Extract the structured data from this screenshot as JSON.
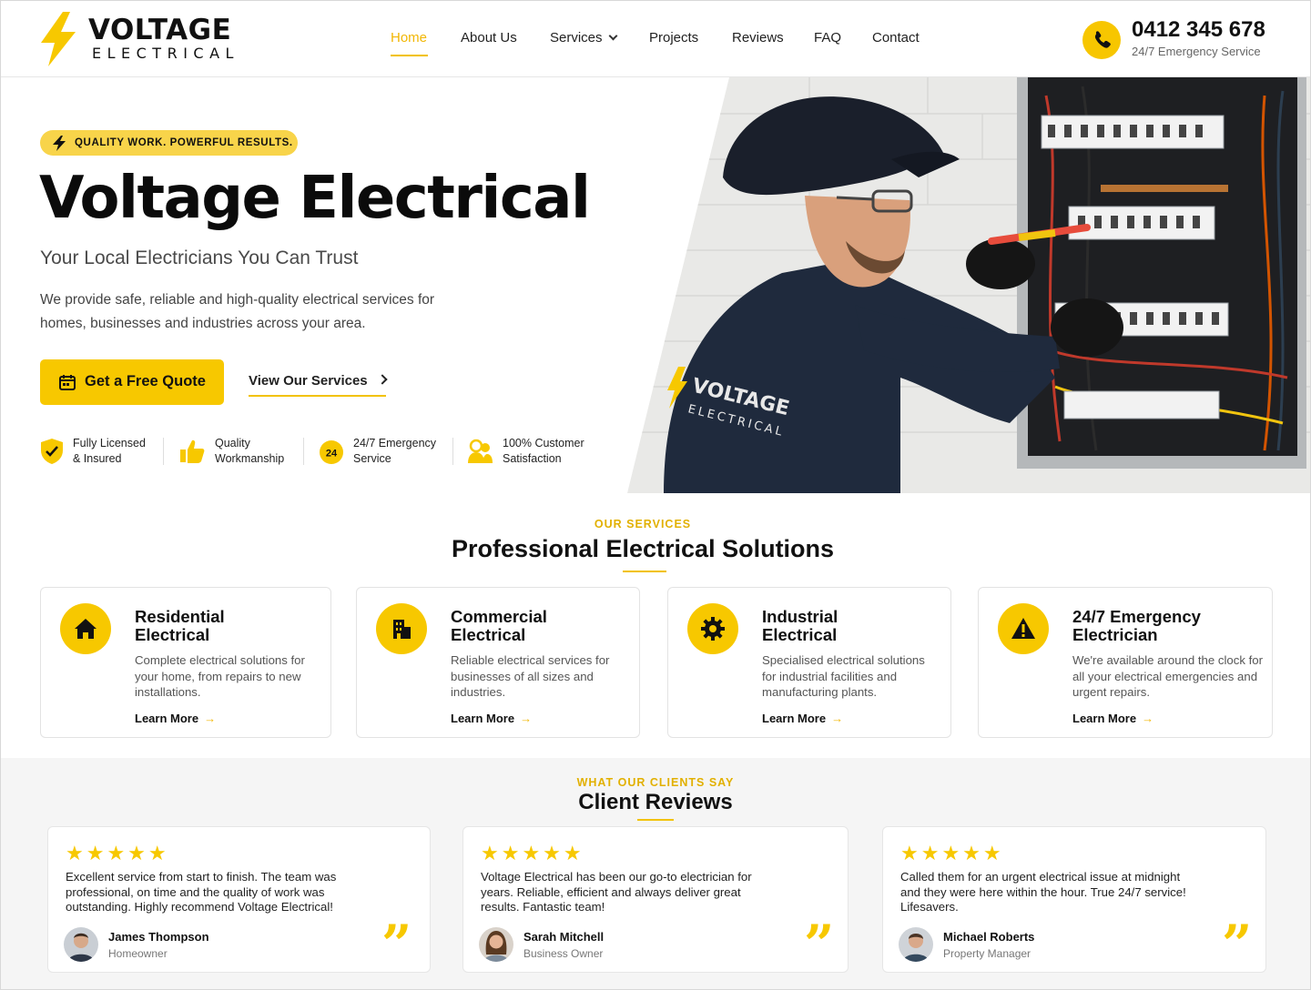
{
  "brand": {
    "name": "VOLTAGE",
    "tagline": "ELECTRICAL",
    "accent_color": "#F7C800"
  },
  "nav": {
    "items": [
      {
        "label": "Home",
        "active": true
      },
      {
        "label": "About Us",
        "active": false
      },
      {
        "label": "Services",
        "active": false,
        "has_dropdown": true
      },
      {
        "label": "Projects",
        "active": false
      },
      {
        "label": "Reviews",
        "active": false
      },
      {
        "label": "FAQ",
        "active": false
      },
      {
        "label": "Contact",
        "active": false
      }
    ]
  },
  "contact": {
    "phone": "0412 345 678",
    "note": "24/7 Emergency Service",
    "icon": "phone-icon"
  },
  "hero": {
    "badge": "QUALITY WORK. POWERFUL RESULTS.",
    "title": "Voltage Electrical",
    "subtitle": "Your Local Electricians You Can Trust",
    "description": "We provide safe, reliable and high-quality electrical services for homes, businesses and industries across your area.",
    "primary_cta": "Get a Free Quote",
    "secondary_cta": "View Our Services",
    "shirt_text_1": "VOLTAGE",
    "shirt_text_2": "ELECTRICAL",
    "features": [
      {
        "line1": "Fully Licensed",
        "line2": "& Insured",
        "icon": "shield-check-icon"
      },
      {
        "line1": "Quality",
        "line2": "Workmanship",
        "icon": "thumbs-up-icon"
      },
      {
        "line1": "24/7 Emergency",
        "line2": "Service",
        "icon": "clock-24-icon",
        "icon_text": "24"
      },
      {
        "line1": "100% Customer",
        "line2": "Satisfaction",
        "icon": "users-icon"
      }
    ]
  },
  "services": {
    "kicker": "OUR SERVICES",
    "title": "Professional Electrical Solutions",
    "learn_more": "Learn More",
    "items": [
      {
        "title_1": "Residential",
        "title_2": "Electrical",
        "text": "Complete electrical solutions for your home, from repairs to new installations.",
        "icon": "house-icon"
      },
      {
        "title_1": "Commercial",
        "title_2": "Electrical",
        "text": "Reliable electrical services for businesses of all sizes and industries.",
        "icon": "building-icon"
      },
      {
        "title_1": "Industrial",
        "title_2": "Electrical",
        "text": "Specialised electrical solutions for industrial facilities and manufacturing plants.",
        "icon": "gear-icon"
      },
      {
        "title_1": "24/7 Emergency",
        "title_2": "Electrician",
        "text": "We're available around the clock for all your electrical emergencies and urgent repairs.",
        "icon": "warning-icon"
      }
    ]
  },
  "reviews": {
    "kicker": "WHAT OUR CLIENTS SAY",
    "title": "Client Reviews",
    "items": [
      {
        "stars": 5,
        "text": "Excellent service from start to finish. The team was professional, on time and the quality of work was outstanding. Highly recommend Voltage Electrical!",
        "name": "James Thompson",
        "role": "Homeowner"
      },
      {
        "stars": 5,
        "text": "Voltage Electrical has been our go-to electrician for years. Reliable, efficient and always deliver great results. Fantastic team!",
        "name": "Sarah Mitchell",
        "role": "Business Owner"
      },
      {
        "stars": 5,
        "text": "Called them for an urgent electrical issue at midnight and they were here within the hour. True 24/7 service! Lifesavers.",
        "name": "Michael Roberts",
        "role": "Property Manager"
      }
    ]
  }
}
